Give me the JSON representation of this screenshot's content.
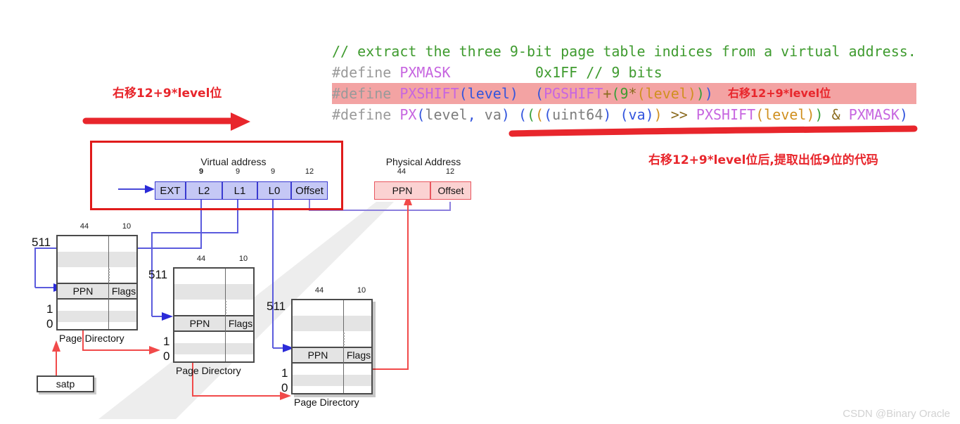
{
  "code": {
    "lines": [
      {
        "tokens": [
          {
            "t": "// extract the three 9-bit page table indices from a virtual address.",
            "c": "c-comment"
          }
        ],
        "highlight": false
      },
      {
        "tokens": [
          {
            "t": "#define ",
            "c": "c-def"
          },
          {
            "t": "PXMASK",
            "c": "c-macro"
          },
          {
            "t": "          ",
            "c": "c-plain"
          },
          {
            "t": "0x1FF",
            "c": "c-num"
          },
          {
            "t": " ",
            "c": "c-plain"
          },
          {
            "t": "// 9 bits",
            "c": "c-comment"
          }
        ],
        "highlight": false
      },
      {
        "tokens": [
          {
            "t": "#define ",
            "c": "c-def"
          },
          {
            "t": "PXSHIFT",
            "c": "c-macro"
          },
          {
            "t": "(",
            "c": "c-p1"
          },
          {
            "t": "level",
            "c": "c-var"
          },
          {
            "t": ")",
            "c": "c-p1"
          },
          {
            "t": "  ",
            "c": "c-plain"
          },
          {
            "t": "(",
            "c": "c-p1"
          },
          {
            "t": "PGSHIFT",
            "c": "c-macro"
          },
          {
            "t": "+",
            "c": "c-op"
          },
          {
            "t": "(",
            "c": "c-p2"
          },
          {
            "t": "9",
            "c": "c-num"
          },
          {
            "t": "*",
            "c": "c-op"
          },
          {
            "t": "(",
            "c": "c-p3"
          },
          {
            "t": "level",
            "c": "c-varo"
          },
          {
            "t": ")",
            "c": "c-p3"
          },
          {
            "t": ")",
            "c": "c-p2"
          },
          {
            "t": ")",
            "c": "c-p1"
          }
        ],
        "highlight": true
      },
      {
        "tokens": [
          {
            "t": "#define ",
            "c": "c-def"
          },
          {
            "t": "PX",
            "c": "c-macro"
          },
          {
            "t": "(",
            "c": "c-p1"
          },
          {
            "t": "level",
            "c": "c-plain"
          },
          {
            "t": ",",
            "c": "c-p1"
          },
          {
            "t": " va",
            "c": "c-plain"
          },
          {
            "t": ")",
            "c": "c-p1"
          },
          {
            "t": " ",
            "c": "c-plain"
          },
          {
            "t": "(",
            "c": "c-p1"
          },
          {
            "t": "(",
            "c": "c-p2"
          },
          {
            "t": "(",
            "c": "c-p3"
          },
          {
            "t": "(",
            "c": "c-p1"
          },
          {
            "t": "uint64",
            "c": "c-plain"
          },
          {
            "t": ")",
            "c": "c-p1"
          },
          {
            "t": " ",
            "c": "c-plain"
          },
          {
            "t": "(",
            "c": "c-p1"
          },
          {
            "t": "va",
            "c": "c-var"
          },
          {
            "t": ")",
            "c": "c-p1"
          },
          {
            "t": ")",
            "c": "c-p3"
          },
          {
            "t": " ",
            "c": "c-plain"
          },
          {
            "t": ">>",
            "c": "c-op"
          },
          {
            "t": " ",
            "c": "c-plain"
          },
          {
            "t": "PXSHIFT",
            "c": "c-macro"
          },
          {
            "t": "(",
            "c": "c-p3"
          },
          {
            "t": "level",
            "c": "c-varo"
          },
          {
            "t": ")",
            "c": "c-p3"
          },
          {
            "t": ")",
            "c": "c-p2"
          },
          {
            "t": " ",
            "c": "c-plain"
          },
          {
            "t": "&",
            "c": "c-op"
          },
          {
            "t": " ",
            "c": "c-plain"
          },
          {
            "t": "PXMASK",
            "c": "c-macro"
          },
          {
            "t": ")",
            "c": "c-p1"
          }
        ],
        "highlight": false
      }
    ],
    "raw_lines": [
      "// extract the three 9-bit page table indices from a virtual address.",
      "#define PXMASK          0x1FF // 9 bits",
      "#define PXSHIFT(level)  (PGSHIFT+(9*(level)))",
      "#define PX(level, va) ((((uint64) (va)) >> PXSHIFT(level)) & PXMASK)"
    ]
  },
  "annotations": {
    "left_note": "右移12+9*level位",
    "code_note": "右移12+9*level位",
    "bottom_note": "右移12+9*level位后,提取出低9位的代码",
    "accent_red": "#e8262c",
    "frame_red": "#e01b1b"
  },
  "virtual_address": {
    "title": "Virtual address",
    "fields": [
      {
        "label": "EXT",
        "bits": ""
      },
      {
        "label": "L2",
        "bits": "9"
      },
      {
        "label": "L1",
        "bits": "9"
      },
      {
        "label": "L0",
        "bits": "9"
      },
      {
        "label": "Offset",
        "bits": "12"
      }
    ],
    "fill": "#c5c8f5",
    "border": "#3a3ad0"
  },
  "physical_address": {
    "title": "Physical Address",
    "fields": [
      {
        "label": "PPN",
        "bits": "44"
      },
      {
        "label": "Offset",
        "bits": "12"
      }
    ],
    "fill": "#fbd2d2",
    "border": "#e8565f"
  },
  "page_directories": [
    {
      "caption": "Page Directory",
      "col_bits": [
        "44",
        "10"
      ],
      "entry_cols": [
        "PPN",
        "Flags"
      ],
      "top_index": "511",
      "bottom_indices": [
        "1",
        "0"
      ]
    },
    {
      "caption": "Page Directory",
      "col_bits": [
        "44",
        "10"
      ],
      "entry_cols": [
        "PPN",
        "Flags"
      ],
      "top_index": "511",
      "bottom_indices": [
        "1",
        "0"
      ]
    },
    {
      "caption": "Page Directory",
      "col_bits": [
        "44",
        "10"
      ],
      "entry_cols": [
        "PPN",
        "Flags"
      ],
      "top_index": "511",
      "bottom_indices": [
        "1",
        "0"
      ]
    }
  ],
  "satp": {
    "label": "satp"
  },
  "watermark": {
    "text": "CSDN @Binary Oracle"
  }
}
